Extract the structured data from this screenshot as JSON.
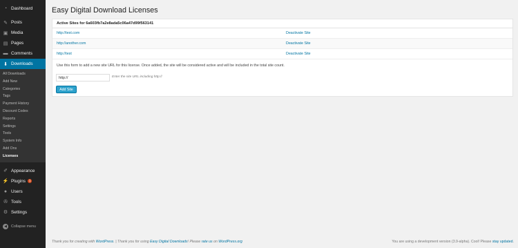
{
  "sidebar": {
    "top": [
      {
        "label": "Dashboard",
        "icon": "dashboard-icon"
      }
    ],
    "main": [
      {
        "label": "Posts",
        "icon": "pin-icon"
      },
      {
        "label": "Media",
        "icon": "media-icon"
      },
      {
        "label": "Pages",
        "icon": "pages-icon"
      },
      {
        "label": "Comments",
        "icon": "comments-icon"
      },
      {
        "label": "Downloads",
        "icon": "download-icon"
      }
    ],
    "submenu": [
      "All Downloads",
      "Add New",
      "Categories",
      "Tags",
      "Payment History",
      "Discount Codes",
      "Reports",
      "Settings",
      "Tools",
      "System Info",
      "Add Ons",
      "Licenses"
    ],
    "lower": [
      {
        "label": "Appearance",
        "icon": "brush-icon"
      },
      {
        "label": "Plugins",
        "icon": "plugin-icon",
        "badge": "1"
      },
      {
        "label": "Users",
        "icon": "users-icon"
      },
      {
        "label": "Tools",
        "icon": "wrench-icon"
      },
      {
        "label": "Settings",
        "icon": "settings-icon"
      }
    ],
    "collapse_label": "Collapse menu"
  },
  "page": {
    "title": "Easy Digital Download Licenses",
    "panel_heading": "Active Sites for 6a603fb7a2e8ada5c06a47d99f563141",
    "sites": [
      {
        "url": "http://test.com",
        "action": "Deactivate Site"
      },
      {
        "url": "http://another.com",
        "action": "Deactivate Site"
      },
      {
        "url": "http://test",
        "action": "Deactivate Site"
      }
    ],
    "description": "Use this form to add a new site URL for this license. Once added, the site will be considered active and will be included in the total site count.",
    "input_value": "http://",
    "input_hint": "Enter the site URL including http://",
    "add_button": "Add Site"
  },
  "footer": {
    "left_1": "Thank you for creating with ",
    "left_link1": "WordPress",
    "left_2": ". | Thank you for using ",
    "left_link2": "Easy Digital Downloads",
    "left_3": "! Please ",
    "left_link3": "rate us",
    "left_4": " on ",
    "left_link4": "WordPress.org",
    "right_1": "You are using a development version (3.9-alpha). Cool! Please ",
    "right_link": "stay updated",
    "right_2": "."
  },
  "colors": {
    "accent": "#0074a2",
    "sidebar_bg": "#222222",
    "button": "#2ea2cc"
  }
}
